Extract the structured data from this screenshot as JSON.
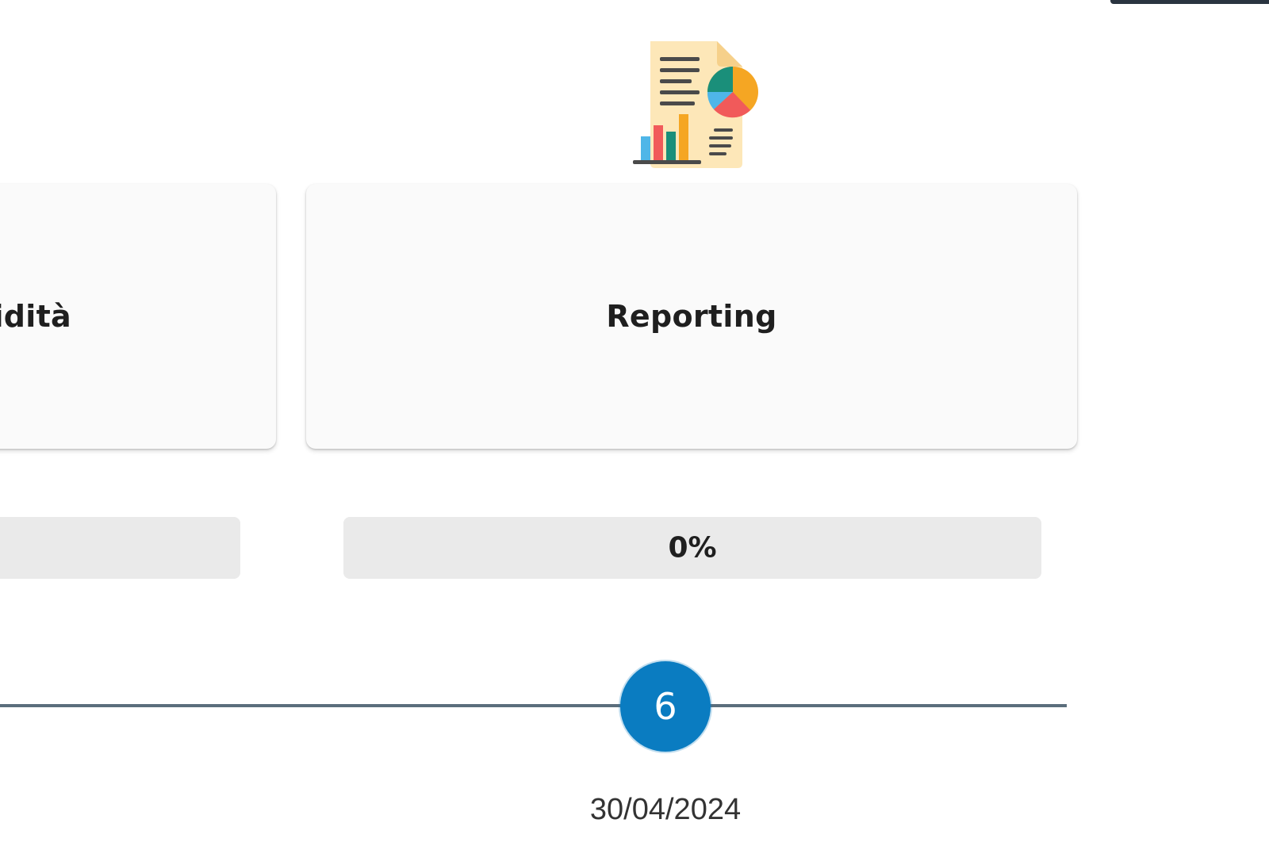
{
  "cards": [
    {
      "title": "idità"
    },
    {
      "title": "Reporting",
      "icon": "report-document-icon"
    }
  ],
  "progress": [
    {
      "value": 0,
      "label": ""
    },
    {
      "value": 0,
      "label": "0%"
    }
  ],
  "timeline": {
    "step_number": "6",
    "date": "30/04/2024"
  },
  "colors": {
    "accent": "#0a7cc1",
    "card_background": "#fafafa",
    "progress_track": "#eaeaea",
    "timeline_line": "#5b6e7c",
    "text": "#1f1f1f",
    "icon_paper": "#fde7b8",
    "icon_lines": "#4a4a4a",
    "icon_teal": "#1a8f7a",
    "icon_orange": "#f5a623",
    "icon_red": "#f15a5a",
    "icon_blue": "#4fb6e8"
  }
}
